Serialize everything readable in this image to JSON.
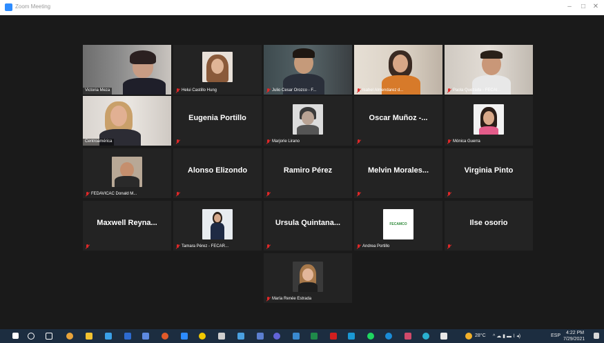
{
  "window": {
    "title": "Zoom Meeting"
  },
  "participants": [
    {
      "name": "Victoria Meza",
      "display": "",
      "muted": false
    },
    {
      "name": "Helui Castillo Hung",
      "display": "",
      "muted": true
    },
    {
      "name": "Julio Cesar Orozco - F...",
      "display": "",
      "muted": true
    },
    {
      "name": "Isabel Almendarez d...",
      "display": "",
      "muted": true
    },
    {
      "name": "Paola Quezada - FECAl...",
      "display": "",
      "muted": true
    },
    {
      "name": "Centroamérica",
      "display": "",
      "muted": false
    },
    {
      "name": "",
      "display": "Eugenia Portillo",
      "muted": true
    },
    {
      "name": "Marjorie Lirano",
      "display": "",
      "muted": true
    },
    {
      "name": "",
      "display": "Oscar Muñoz -...",
      "muted": true
    },
    {
      "name": "Mónica Guerra",
      "display": "",
      "muted": true
    },
    {
      "name": "FEDAVICAC Donald M...",
      "display": "",
      "muted": true
    },
    {
      "name": "",
      "display": "Alonso Elizondo",
      "muted": true
    },
    {
      "name": "",
      "display": "Ramiro Pérez",
      "muted": true
    },
    {
      "name": "",
      "display": "Melvin Morales...",
      "muted": true
    },
    {
      "name": "",
      "display": "Virginia Pinto",
      "muted": true
    },
    {
      "name": "",
      "display": "Maxwell Reyna...",
      "muted": true
    },
    {
      "name": "Tamara Pérez - FECAR...",
      "display": "",
      "muted": true
    },
    {
      "name": "",
      "display": "Ursula Quintana...",
      "muted": true
    },
    {
      "name": "Andrea Portillo",
      "display": "",
      "muted": true
    },
    {
      "name": "",
      "display": "Ilse osorio",
      "muted": true
    },
    {
      "name": "María Renée Estrada",
      "display": "",
      "muted": true
    }
  ],
  "thumb_logo_text": "FECAMCO",
  "taskbar": {
    "weather": "28°C",
    "language": "ESP",
    "time": "4:22 PM",
    "date": "7/29/2021"
  },
  "colors": {
    "active_speaker": "#d8e35c",
    "muted": "#e02828",
    "tile_bg": "#232323",
    "stage_bg": "#1a1a1a",
    "taskbar_bg": "#1c2d40"
  }
}
